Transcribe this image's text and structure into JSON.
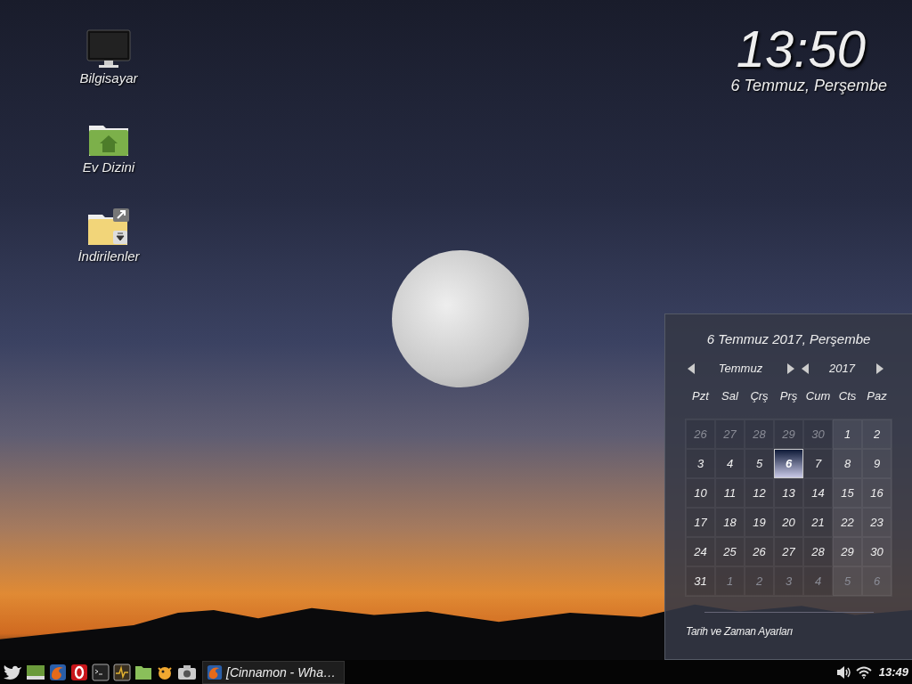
{
  "desktop_icons": [
    {
      "label": "Bilgisayar",
      "kind": "computer"
    },
    {
      "label": "Ev Dizini",
      "kind": "home-folder"
    },
    {
      "label": "İndirilenler",
      "kind": "downloads-folder"
    }
  ],
  "clock": {
    "time": "13:50",
    "date": "6 Temmuz, Perşembe"
  },
  "calendar": {
    "title": "6 Temmuz 2017, Perşembe",
    "month": "Temmuz",
    "year": "2017",
    "weekdays": [
      "Pzt",
      "Sal",
      "Çrş",
      "Prş",
      "Cum",
      "Cts",
      "Paz"
    ],
    "weeks": [
      [
        {
          "day": "26",
          "other_month": true,
          "selected": false
        },
        {
          "day": "27",
          "other_month": true,
          "selected": false
        },
        {
          "day": "28",
          "other_month": true,
          "selected": false
        },
        {
          "day": "29",
          "other_month": true,
          "selected": false
        },
        {
          "day": "30",
          "other_month": true,
          "selected": false
        },
        {
          "day": "1",
          "other_month": false,
          "selected": false
        },
        {
          "day": "2",
          "other_month": false,
          "selected": false
        }
      ],
      [
        {
          "day": "3",
          "other_month": false,
          "selected": false
        },
        {
          "day": "4",
          "other_month": false,
          "selected": false
        },
        {
          "day": "5",
          "other_month": false,
          "selected": false
        },
        {
          "day": "6",
          "other_month": false,
          "selected": true
        },
        {
          "day": "7",
          "other_month": false,
          "selected": false
        },
        {
          "day": "8",
          "other_month": false,
          "selected": false
        },
        {
          "day": "9",
          "other_month": false,
          "selected": false
        }
      ],
      [
        {
          "day": "10",
          "other_month": false,
          "selected": false
        },
        {
          "day": "11",
          "other_month": false,
          "selected": false
        },
        {
          "day": "12",
          "other_month": false,
          "selected": false
        },
        {
          "day": "13",
          "other_month": false,
          "selected": false
        },
        {
          "day": "14",
          "other_month": false,
          "selected": false
        },
        {
          "day": "15",
          "other_month": false,
          "selected": false
        },
        {
          "day": "16",
          "other_month": false,
          "selected": false
        }
      ],
      [
        {
          "day": "17",
          "other_month": false,
          "selected": false
        },
        {
          "day": "18",
          "other_month": false,
          "selected": false
        },
        {
          "day": "19",
          "other_month": false,
          "selected": false
        },
        {
          "day": "20",
          "other_month": false,
          "selected": false
        },
        {
          "day": "21",
          "other_month": false,
          "selected": false
        },
        {
          "day": "22",
          "other_month": false,
          "selected": false
        },
        {
          "day": "23",
          "other_month": false,
          "selected": false
        }
      ],
      [
        {
          "day": "24",
          "other_month": false,
          "selected": false
        },
        {
          "day": "25",
          "other_month": false,
          "selected": false
        },
        {
          "day": "26",
          "other_month": false,
          "selected": false
        },
        {
          "day": "27",
          "other_month": false,
          "selected": false
        },
        {
          "day": "28",
          "other_month": false,
          "selected": false
        },
        {
          "day": "29",
          "other_month": false,
          "selected": false
        },
        {
          "day": "30",
          "other_month": false,
          "selected": false
        }
      ],
      [
        {
          "day": "31",
          "other_month": false,
          "selected": false
        },
        {
          "day": "1",
          "other_month": true,
          "selected": false
        },
        {
          "day": "2",
          "other_month": true,
          "selected": false
        },
        {
          "day": "3",
          "other_month": true,
          "selected": false
        },
        {
          "day": "4",
          "other_month": true,
          "selected": false
        },
        {
          "day": "5",
          "other_month": true,
          "selected": false
        },
        {
          "day": "6",
          "other_month": true,
          "selected": false
        }
      ]
    ],
    "settings_link": "Tarih ve Zaman Ayarları"
  },
  "taskbar": {
    "launchers": [
      {
        "kind": "bird"
      },
      {
        "kind": "panel"
      },
      {
        "kind": "browser"
      },
      {
        "kind": "opera"
      },
      {
        "kind": "terminal"
      },
      {
        "kind": "monitor"
      },
      {
        "kind": "folder"
      },
      {
        "kind": "fish"
      },
      {
        "kind": "camera"
      }
    ],
    "windows": [
      {
        "label": "[Cinnamon - Wha…",
        "kind": "browser"
      }
    ],
    "tray": {
      "time": "13:49"
    }
  }
}
